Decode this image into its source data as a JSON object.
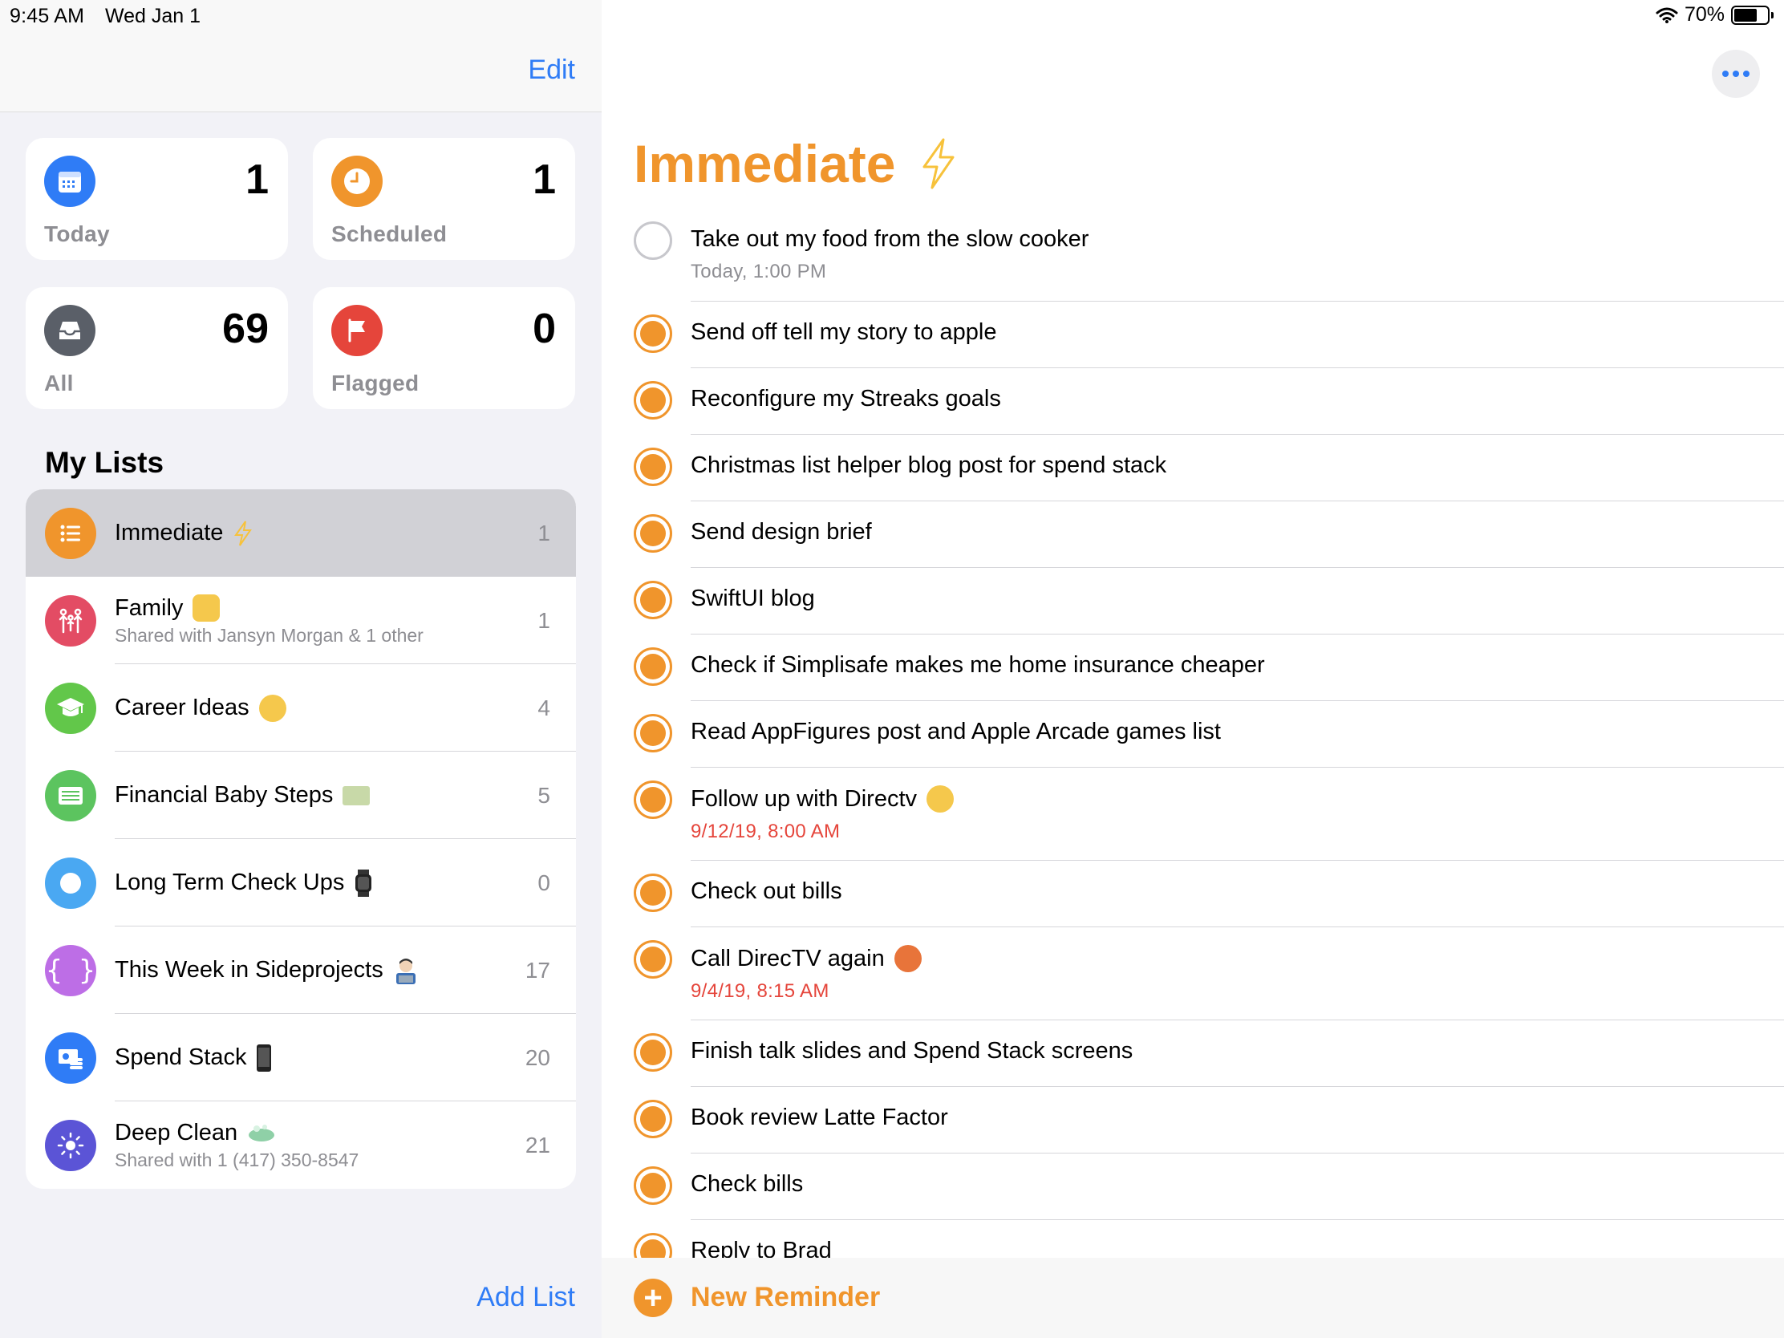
{
  "status_bar": {
    "time": "9:45 AM",
    "date": "Wed Jan 1",
    "battery": "70%"
  },
  "sidebar": {
    "edit_label": "Edit",
    "smart_lists": [
      {
        "label": "Today",
        "count": "1",
        "color": "#2f7cf6",
        "icon": "calendar-icon"
      },
      {
        "label": "Scheduled",
        "count": "1",
        "color": "#f0952c",
        "icon": "clock-icon"
      },
      {
        "label": "All",
        "count": "69",
        "color": "#5a5f68",
        "icon": "tray-icon"
      },
      {
        "label": "Flagged",
        "count": "0",
        "color": "#e5453b",
        "icon": "flag-icon"
      }
    ],
    "my_lists_title": "My Lists",
    "lists": [
      {
        "name": "Immediate",
        "subtitle": "",
        "count": "1",
        "color": "#f0952c",
        "icon": "list-bullet-icon"
      },
      {
        "name": "Family",
        "subtitle": "Shared with Jansyn Morgan & 1 other",
        "count": "1",
        "color": "#e34c64",
        "icon": "family-icon"
      },
      {
        "name": "Career Ideas",
        "subtitle": "",
        "count": "4",
        "color": "#62c74a",
        "icon": "graduation-cap-icon"
      },
      {
        "name": "Financial Baby Steps",
        "subtitle": "",
        "count": "5",
        "color": "#5cc45f",
        "icon": "money-icon"
      },
      {
        "name": "Long Term Check Ups",
        "subtitle": "",
        "count": "0",
        "color": "#4aa8f2",
        "icon": "circle-icon"
      },
      {
        "name": "This Week in Sideprojects",
        "subtitle": "",
        "count": "17",
        "color": "#bd6ee6",
        "icon": "braces-icon"
      },
      {
        "name": "Spend Stack",
        "subtitle": "",
        "count": "20",
        "color": "#2f7cf6",
        "icon": "money-bills-icon"
      },
      {
        "name": "Deep Clean",
        "subtitle": "Shared with 1 (417) 350-8547",
        "count": "21",
        "color": "#5b54d6",
        "icon": "sun-icon"
      }
    ],
    "add_list_label": "Add List"
  },
  "main": {
    "title": "Immediate",
    "title_emoji": "lightning-icon",
    "reminders": [
      {
        "title": "Take out my food from the slow cooker",
        "date": "Today, 1:00 PM",
        "overdue": false,
        "completed": false
      },
      {
        "title": "Send off tell my story to apple",
        "date": "",
        "overdue": false,
        "completed": true
      },
      {
        "title": "Reconfigure my Streaks goals",
        "date": "",
        "overdue": false,
        "completed": true
      },
      {
        "title": "Christmas list helper blog post for spend stack",
        "date": "",
        "overdue": false,
        "completed": true
      },
      {
        "title": "Send design brief",
        "date": "",
        "overdue": false,
        "completed": true
      },
      {
        "title": "SwiftUI blog",
        "date": "",
        "overdue": false,
        "completed": true
      },
      {
        "title": "Check if Simplisafe makes me home insurance cheaper",
        "date": "",
        "overdue": false,
        "completed": true
      },
      {
        "title": "Read AppFigures post and Apple Arcade games list",
        "date": "",
        "overdue": false,
        "completed": true
      },
      {
        "title": "Follow up with Directv",
        "date": "9/12/19, 8:00 AM",
        "overdue": true,
        "completed": true
      },
      {
        "title": "Check out bills",
        "date": "",
        "overdue": false,
        "completed": true
      },
      {
        "title": "Call DirecTV again",
        "date": "9/4/19, 8:15 AM",
        "overdue": true,
        "completed": true
      },
      {
        "title": "Finish talk slides and Spend Stack screens",
        "date": "",
        "overdue": false,
        "completed": true
      },
      {
        "title": "Book review Latte Factor",
        "date": "",
        "overdue": false,
        "completed": true
      },
      {
        "title": "Check bills",
        "date": "",
        "overdue": false,
        "completed": true
      },
      {
        "title": "Reply to Brad",
        "date": "",
        "overdue": false,
        "completed": true
      }
    ],
    "new_reminder_label": "New Reminder"
  }
}
